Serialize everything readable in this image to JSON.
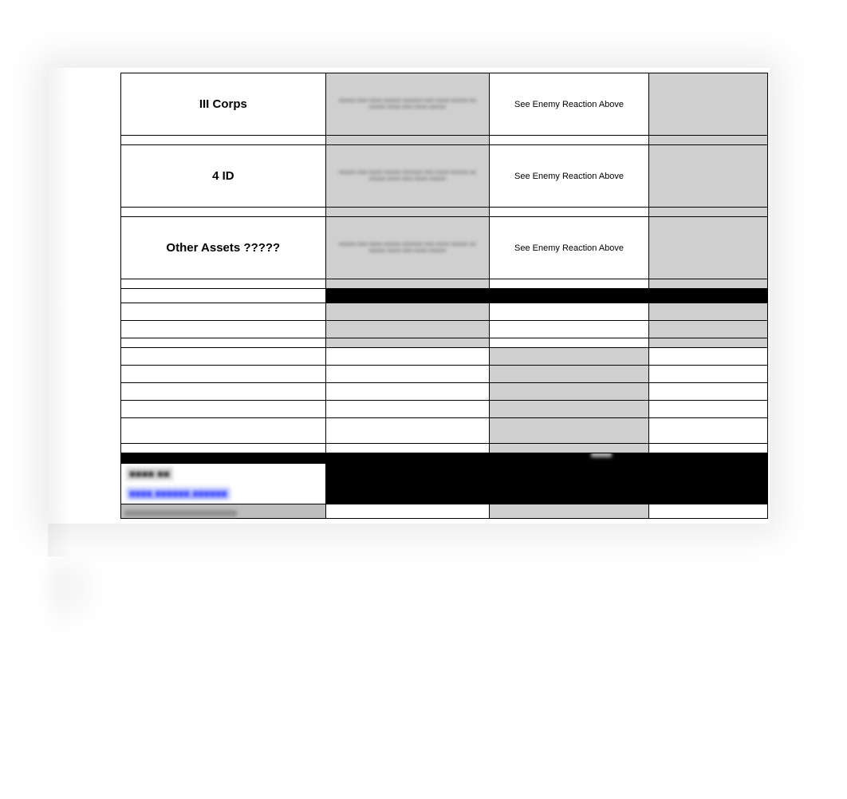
{
  "rows": [
    {
      "unit": "III Corps",
      "reaction": "See Enemy Reaction Above"
    },
    {
      "unit": "4 ID",
      "reaction": "See Enemy Reaction Above"
    },
    {
      "unit": "Other Assets ?????",
      "reaction": "See Enemy Reaction Above"
    }
  ],
  "blurBlock": "■■■■■ ■■■ ■■■■ ■■■■■ ■■■■■■ ■■■ ■■■■ ■■■■■ ■■ ■■■■■ ■■■■ ■■■ ■■■■ ■■■■■",
  "footer": {
    "line1": "■■■■ ■■",
    "line2": "■■■■ ■■■■■■ ■■■■■■"
  }
}
